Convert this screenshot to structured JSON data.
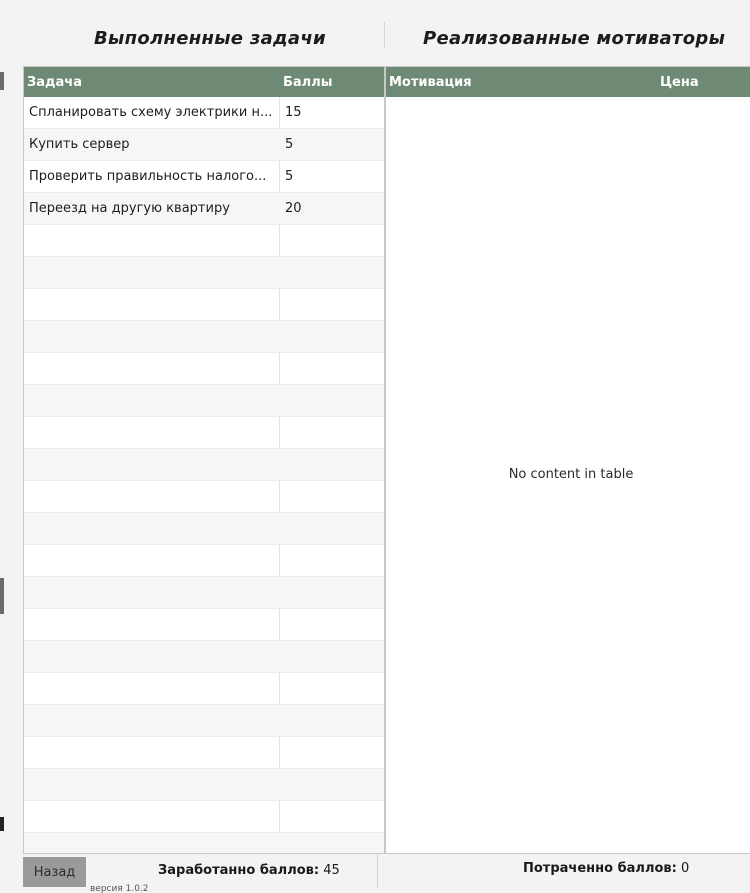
{
  "left_heading": "Выполненные задачи",
  "right_heading": "Реализованные мотиваторы",
  "tasks_table": {
    "col_task": "Задача",
    "col_points": "Баллы",
    "rows": [
      {
        "task": "Спланировать схему электрики н...",
        "points": "15"
      },
      {
        "task": "Купить сервер",
        "points": "5"
      },
      {
        "task": "Проверить правильность налого...",
        "points": "5"
      },
      {
        "task": "Переезд на другую квартиру",
        "points": "20"
      }
    ]
  },
  "motivators_table": {
    "col_motivation": "Мотивация",
    "col_price": "Цена",
    "empty_text": "No content in table"
  },
  "footer": {
    "back_label": "Назад",
    "earned_label": "Заработанно баллов:",
    "earned_value": "45",
    "spent_label": "Потраченно баллов:",
    "spent_value": "0",
    "version_text": "версия 1.0.2"
  },
  "colors": {
    "header_bg": "#6f8a74",
    "button_bg": "#9a9a9a"
  }
}
